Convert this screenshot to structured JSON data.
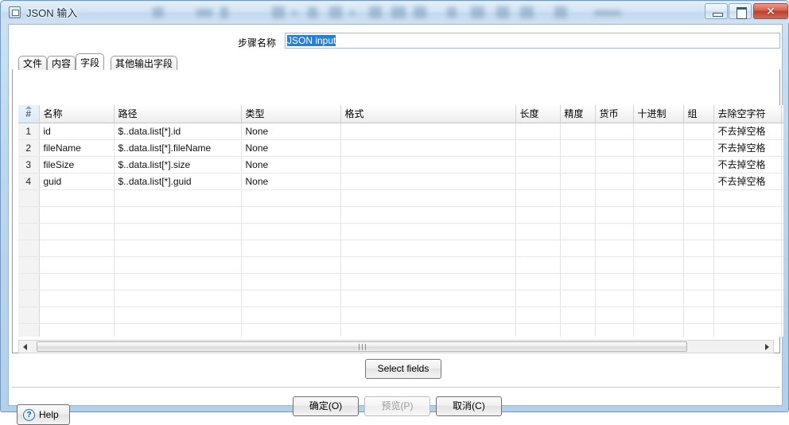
{
  "window": {
    "title": "JSON 输入",
    "icon": "window-icon",
    "buttons": {
      "minimize": "minimize-icon",
      "maximize": "maximize-icon",
      "close": "✕"
    }
  },
  "step": {
    "label": "步骤名称",
    "value": "JSON input",
    "placeholder": ""
  },
  "tabs": [
    {
      "label": "文件",
      "active": false
    },
    {
      "label": "内容",
      "active": false
    },
    {
      "label": "字段",
      "active": true
    },
    {
      "label": "其他输出字段",
      "active": false
    }
  ],
  "table": {
    "columns": [
      "#",
      "名称",
      "路径",
      "类型",
      "格式",
      "长度",
      "精度",
      "货币",
      "十进制",
      "组",
      "去除空字符"
    ],
    "rows": [
      {
        "num": "1",
        "name": "id",
        "path": "$..data.list[*].id",
        "type": "None",
        "format": "",
        "length": "",
        "precision": "",
        "currency": "",
        "decimal": "",
        "group": "",
        "trim": "不去掉空格"
      },
      {
        "num": "2",
        "name": "fileName",
        "path": "$..data.list[*].fileName",
        "type": "None",
        "format": "",
        "length": "",
        "precision": "",
        "currency": "",
        "decimal": "",
        "group": "",
        "trim": "不去掉空格"
      },
      {
        "num": "3",
        "name": "fileSize",
        "path": "$..data.list[*].size",
        "type": "None",
        "format": "",
        "length": "",
        "precision": "",
        "currency": "",
        "decimal": "",
        "group": "",
        "trim": "不去掉空格"
      },
      {
        "num": "4",
        "name": "guid",
        "path": "$..data.list[*].guid",
        "type": "None",
        "format": "",
        "length": "",
        "precision": "",
        "currency": "",
        "decimal": "",
        "group": "",
        "trim": "不去掉空格"
      }
    ],
    "empty_row_count": 10
  },
  "actions": {
    "select_fields": "Select fields",
    "ok": "确定(O)",
    "preview": "预览(P)",
    "cancel": "取消(C)",
    "help": "Help",
    "help_icon": "?"
  },
  "colors": {
    "frame": "#b2d0ea",
    "selection": "#2a7fd4",
    "close_button": "#bc3f2c"
  }
}
